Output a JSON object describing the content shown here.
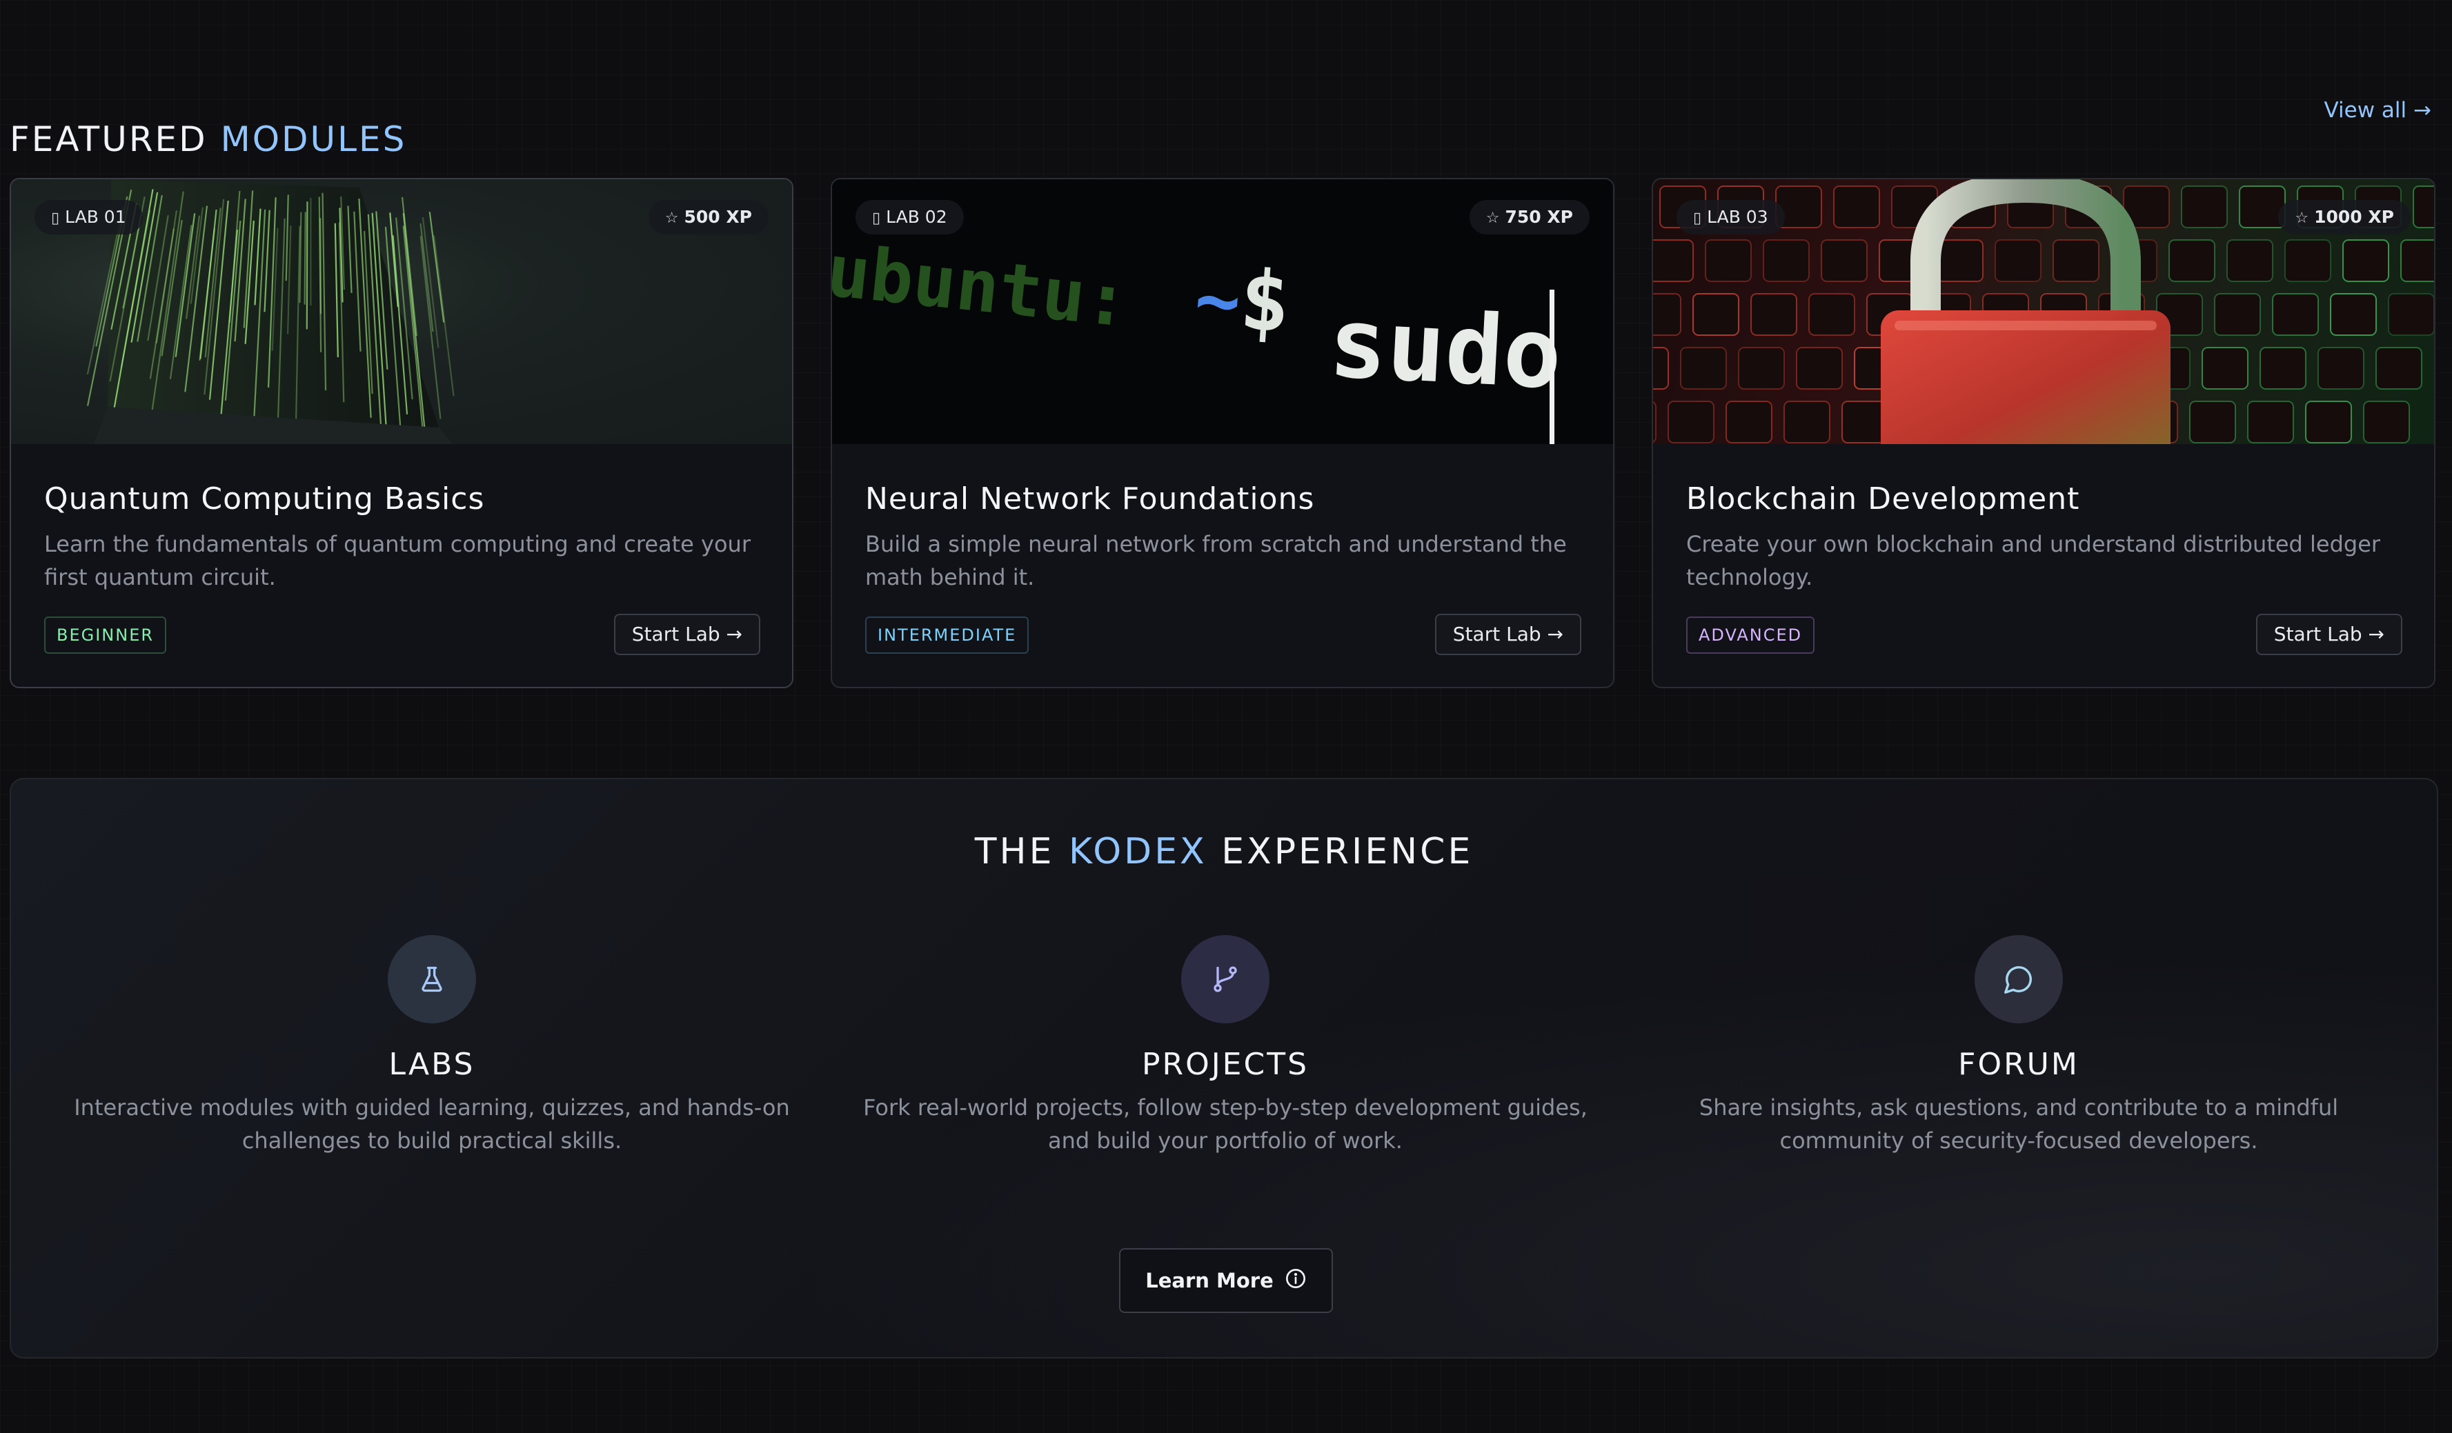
{
  "featured": {
    "title_main": "FEATURED",
    "title_accent": "MODULES",
    "view_all": "View all →"
  },
  "modules": [
    {
      "lab": "LAB 01",
      "xp": "500 XP",
      "title": "Quantum Computing Basics",
      "description": "Learn the fundamentals of quantum computing and create your first quantum circuit.",
      "level": "BEGINNER",
      "action": "Start Lab →"
    },
    {
      "lab": "LAB 02",
      "xp": "750 XP",
      "title": "Neural Network Foundations",
      "description": "Build a simple neural network from scratch and understand the math behind it.",
      "level": "INTERMEDIATE",
      "action": "Start Lab →",
      "terminal_prompt": "ubuntu:",
      "terminal_path": "~",
      "terminal_dollar": "$",
      "terminal_cmd": "sudo"
    },
    {
      "lab": "LAB 03",
      "xp": "1000 XP",
      "title": "Blockchain Development",
      "description": "Create your own blockchain and understand distributed ledger technology.",
      "level": "ADVANCED",
      "action": "Start Lab →"
    }
  ],
  "experience": {
    "title_pre": "THE",
    "title_accent": "KODEX",
    "title_post": "EXPERIENCE",
    "features": [
      {
        "name": "LABS",
        "description": "Interactive modules with guided learning, quizzes, and hands-on challenges to build practical skills."
      },
      {
        "name": "PROJECTS",
        "description": "Fork real-world projects, follow step-by-step development guides, and build your portfolio of work."
      },
      {
        "name": "FORUM",
        "description": "Share insights, ask questions, and contribute to a mindful community of security-focused developers."
      }
    ],
    "learn_more": "Learn More"
  },
  "icons": {
    "lab_badge": "clipboard-icon",
    "xp": "star-icon",
    "labs": "flask-icon",
    "projects": "git-branch-icon",
    "forum": "chat-bubble-icon",
    "learn_more": "info-icon"
  },
  "colors": {
    "accent": "#93c5fd",
    "beginner": "#86efac",
    "intermediate": "#7dd3fc",
    "advanced": "#d8b4fe",
    "background": "#0e0e11",
    "card": "#111217"
  }
}
